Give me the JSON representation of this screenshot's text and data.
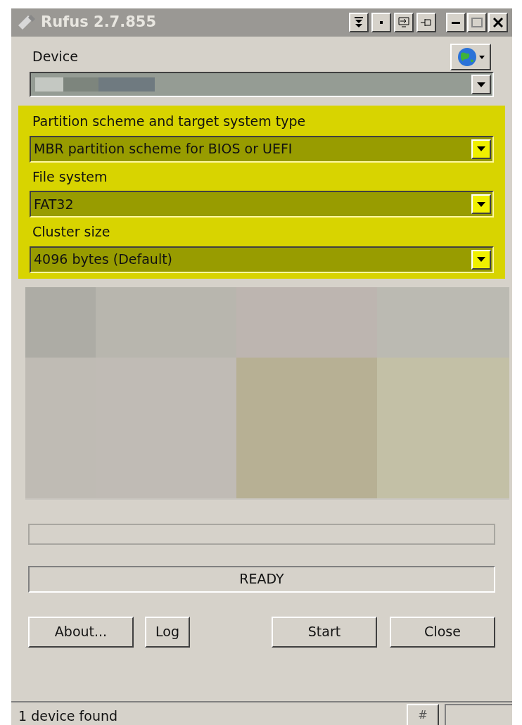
{
  "window": {
    "title": "Rufus 2.7.855"
  },
  "device": {
    "label": "Device",
    "redacted": true
  },
  "highlighted_group": {
    "highlighted": true,
    "fields": [
      {
        "label": "Partition scheme and target system type",
        "value": "MBR partition scheme for BIOS or UEFI"
      },
      {
        "label": "File system",
        "value": "FAT32"
      },
      {
        "label": "Cluster size",
        "value": "4096 bytes (Default)"
      }
    ]
  },
  "progress": {
    "level": 0
  },
  "status": "READY",
  "buttons": [
    "About...",
    "Log",
    "Start",
    "Close"
  ],
  "status_bar": {
    "text": "1 device found",
    "button": "#"
  }
}
